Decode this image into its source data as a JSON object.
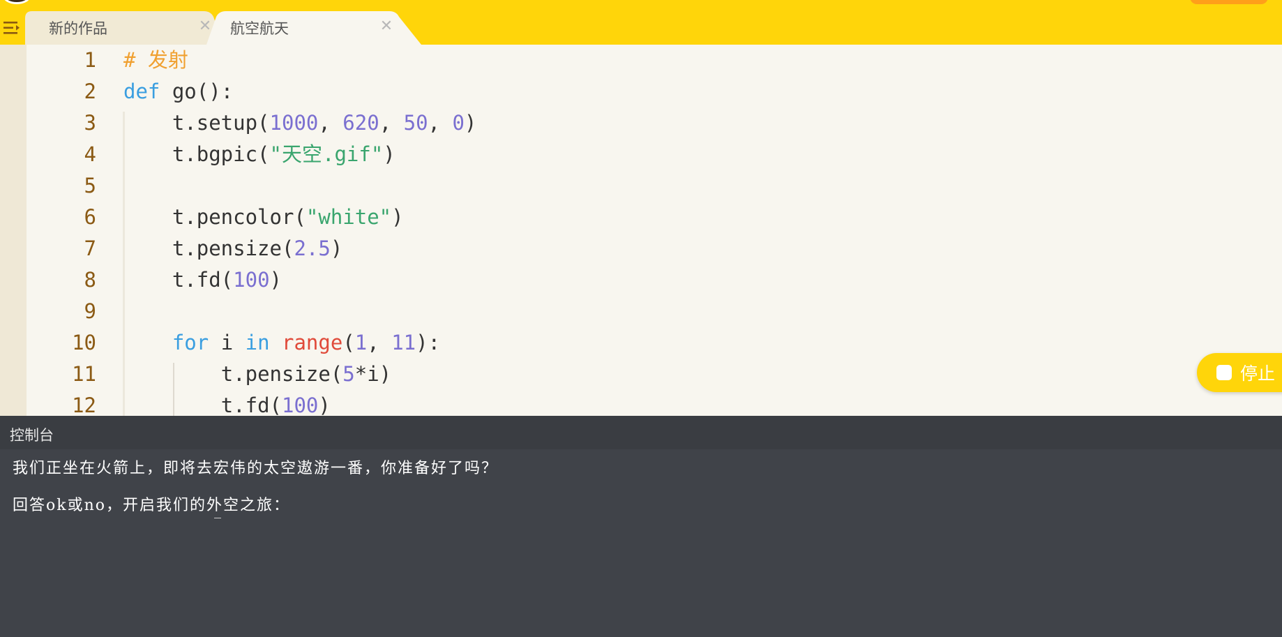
{
  "tabs": [
    {
      "label": "新的作品",
      "close": "✕",
      "active": false
    },
    {
      "label": "航空航天",
      "close": "✕",
      "active": true
    }
  ],
  "editor": {
    "line_numbers": [
      "1",
      "2",
      "3",
      "4",
      "5",
      "6",
      "7",
      "8",
      "9",
      "10",
      "11",
      "12"
    ]
  },
  "stop_button": {
    "label": "停止"
  },
  "console": {
    "title": "控制台",
    "lines": [
      "我们正坐在火箭上，即将去宏伟的太空遨游一番，你准备好了吗？",
      "回答ok或no，开启我们的外空之旅："
    ]
  },
  "colors": {
    "brand_yellow": "#ffd50a",
    "editor_bg": "#f8f6ef",
    "console_bg": "#404349",
    "line_number": "#8b5a14",
    "comment": "#f0a030",
    "keyword": "#3a9ee0",
    "number": "#7a6fd0",
    "string": "#3aa56e",
    "builtin": "#e04a3a"
  },
  "icons": {
    "menu": "menu-collapse-icon",
    "stop": "stop-square-icon",
    "close": "close-icon"
  },
  "code": {
    "l1": {
      "comment": "# 发射"
    },
    "l2": {
      "kw": "def",
      "rest": " go():"
    },
    "l3": {
      "indent": "    ",
      "a": "t.setup(",
      "n1": "1000",
      "s1": ", ",
      "n2": "620",
      "s2": ", ",
      "n3": "50",
      "s3": ", ",
      "n4": "0",
      "end": ")"
    },
    "l4": {
      "indent": "    ",
      "a": "t.bgpic(",
      "str": "\"天空.gif\"",
      "end": ")"
    },
    "l5": {},
    "l6": {
      "indent": "    ",
      "a": "t.pencolor(",
      "str": "\"white\"",
      "end": ")"
    },
    "l7": {
      "indent": "    ",
      "a": "t.pensize(",
      "num": "2.5",
      "end": ")"
    },
    "l8": {
      "indent": "    ",
      "a": "t.fd(",
      "num": "100",
      "end": ")"
    },
    "l9": {},
    "l10": {
      "indent": "    ",
      "kw1": "for",
      "mid1": " i ",
      "kw2": "in",
      "sp": " ",
      "bi": "range",
      "p": "(",
      "n1": "1",
      "s1": ", ",
      "n2": "11",
      "end": "):"
    },
    "l11": {
      "indent": "        ",
      "a": "t.pensize(",
      "num": "5",
      "end": "*i)"
    },
    "l12": {
      "indent": "        ",
      "a": "t.fd(",
      "num": "100",
      "end": ")"
    }
  }
}
